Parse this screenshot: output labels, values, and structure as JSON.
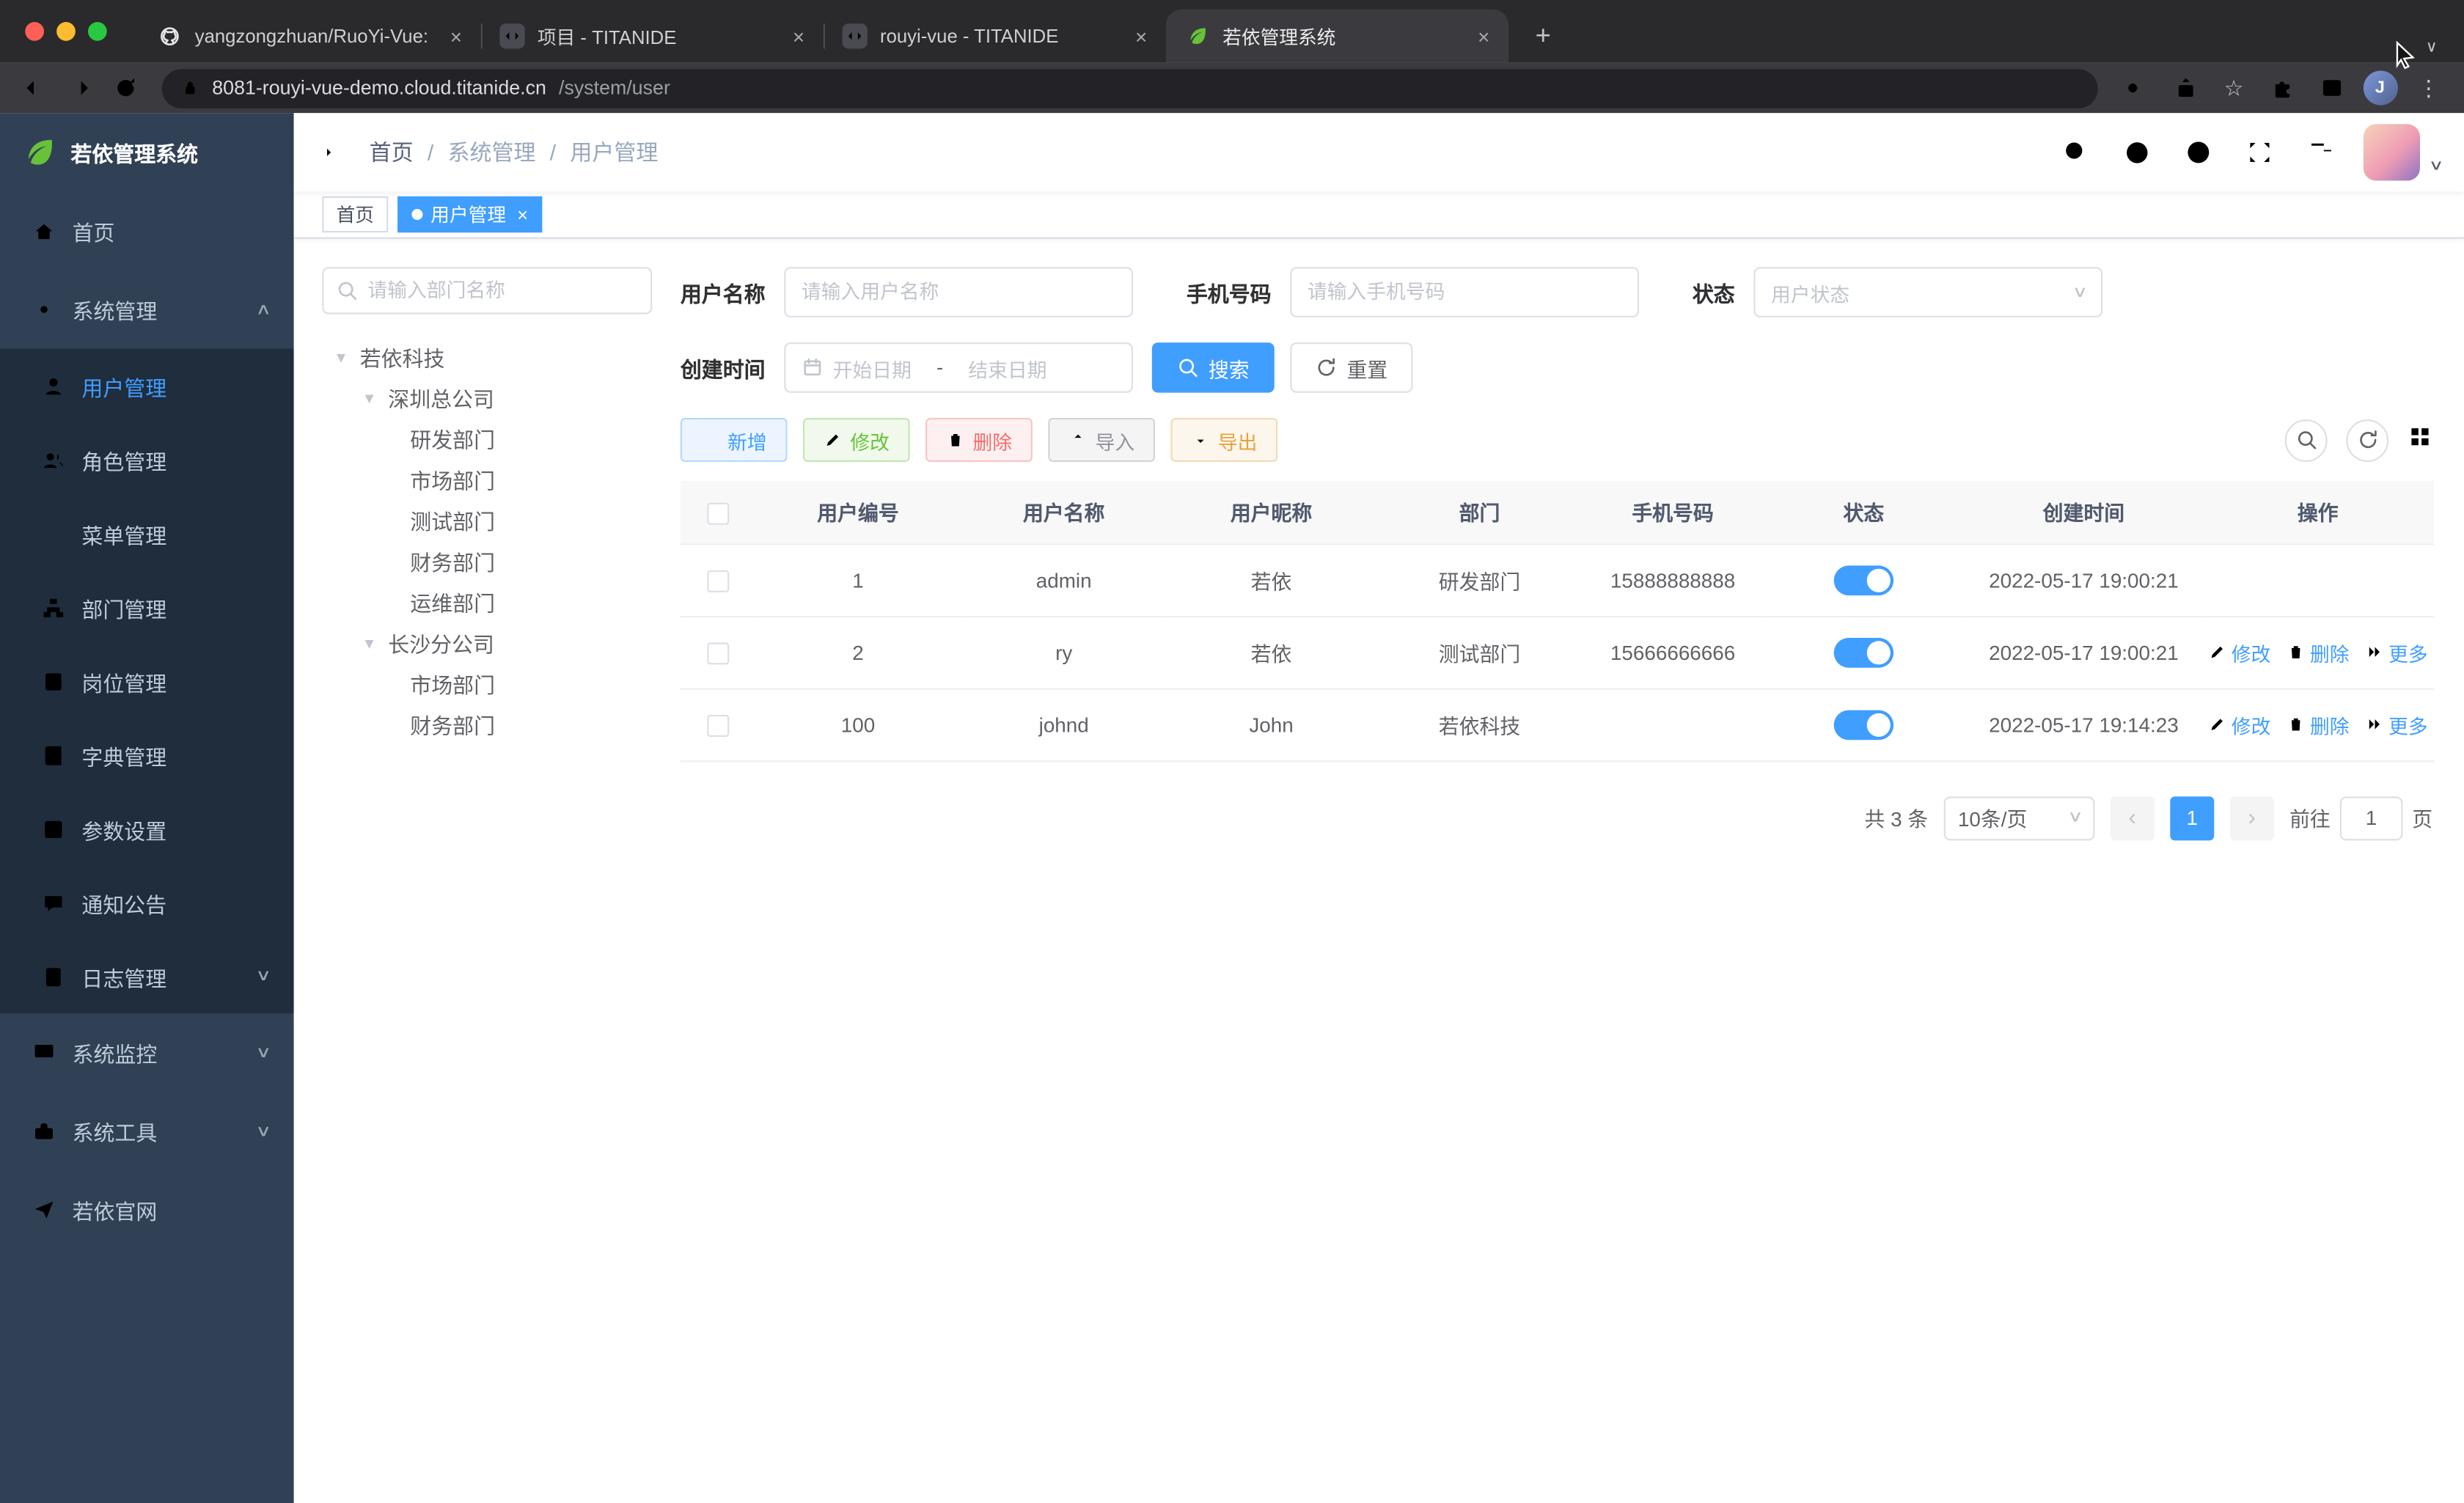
{
  "browser": {
    "tabs": [
      {
        "title": "yangzongzhuan/RuoYi-Vue: (R"
      },
      {
        "title": "项目 - TITANIDE"
      },
      {
        "title": "rouyi-vue - TITANIDE"
      },
      {
        "title": "若依管理系统"
      }
    ],
    "url_domain": "8081-rouyi-vue-demo.cloud.titanide.cn",
    "url_path": "/system/user",
    "profile_initial": "J"
  },
  "sidebar": {
    "logo_title": "若依管理系统",
    "home": "首页",
    "system": "系统管理",
    "system_items": [
      {
        "label": "用户管理"
      },
      {
        "label": "角色管理"
      },
      {
        "label": "菜单管理"
      },
      {
        "label": "部门管理"
      },
      {
        "label": "岗位管理"
      },
      {
        "label": "字典管理"
      },
      {
        "label": "参数设置"
      },
      {
        "label": "通知公告"
      },
      {
        "label": "日志管理"
      }
    ],
    "monitor": "系统监控",
    "tools": "系统工具",
    "site": "若依官网"
  },
  "navbar": {
    "separator": "/",
    "breadcrumb": [
      {
        "label": "首页"
      },
      {
        "label": "系统管理"
      },
      {
        "label": "用户管理"
      }
    ]
  },
  "tags": {
    "home": "首页",
    "active": "用户管理"
  },
  "dept": {
    "search_placeholder": "请输入部门名称",
    "nodes": [
      {
        "label": "若依科技"
      },
      {
        "label": "深圳总公司"
      },
      {
        "label": "研发部门"
      },
      {
        "label": "市场部门"
      },
      {
        "label": "测试部门"
      },
      {
        "label": "财务部门"
      },
      {
        "label": "运维部门"
      },
      {
        "label": "长沙分公司"
      },
      {
        "label": "市场部门"
      },
      {
        "label": "财务部门"
      }
    ]
  },
  "filters": {
    "username_label": "用户名称",
    "username_placeholder": "请输入用户名称",
    "phone_label": "手机号码",
    "phone_placeholder": "请输入手机号码",
    "status_label": "状态",
    "status_placeholder": "用户状态",
    "created_label": "创建时间",
    "date_start": "开始日期",
    "date_separator": "-",
    "date_end": "结束日期",
    "search_button": "搜索",
    "reset_button": "重置"
  },
  "toolbar": {
    "add": "新增",
    "edit": "修改",
    "delete": "删除",
    "import": "导入",
    "export": "导出"
  },
  "table": {
    "headers": [
      {
        "label": "用户编号"
      },
      {
        "label": "用户名称"
      },
      {
        "label": "用户昵称"
      },
      {
        "label": "部门"
      },
      {
        "label": "手机号码"
      },
      {
        "label": "状态"
      },
      {
        "label": "创建时间"
      },
      {
        "label": "操作"
      }
    ],
    "rows": [
      {
        "id": "1",
        "username": "admin",
        "nickname": "若依",
        "dept": "研发部门",
        "phone": "15888888888",
        "created": "2022-05-17 19:00:21"
      },
      {
        "id": "2",
        "username": "ry",
        "nickname": "若依",
        "dept": "测试部门",
        "phone": "15666666666",
        "created": "2022-05-17 19:00:21"
      },
      {
        "id": "100",
        "username": "johnd",
        "nickname": "John",
        "dept": "若依科技",
        "phone": "",
        "created": "2022-05-17 19:14:23"
      }
    ],
    "op_edit": "修改",
    "op_delete": "删除",
    "op_more": "更多"
  },
  "pagination": {
    "total": "共 3 条",
    "page_size": "10条/页",
    "current_page": "1",
    "goto_label": "前往",
    "goto_value": "1",
    "goto_unit": "页"
  },
  "icons": {
    "close": "×",
    "new_tab": "+",
    "star": "☆",
    "more_vertical": "⋮",
    "arrow_up": "∧",
    "arrow_down": "∨",
    "caret_expanded": "▾",
    "prev": "‹",
    "next": "›"
  },
  "colors": {
    "primary": "#409EFF",
    "success": "#67C23A",
    "danger": "#F56C6C",
    "warning": "#E6A23C",
    "info": "#909399",
    "sidebar": "#304156",
    "sidebar_sub": "#1f2d3d"
  }
}
